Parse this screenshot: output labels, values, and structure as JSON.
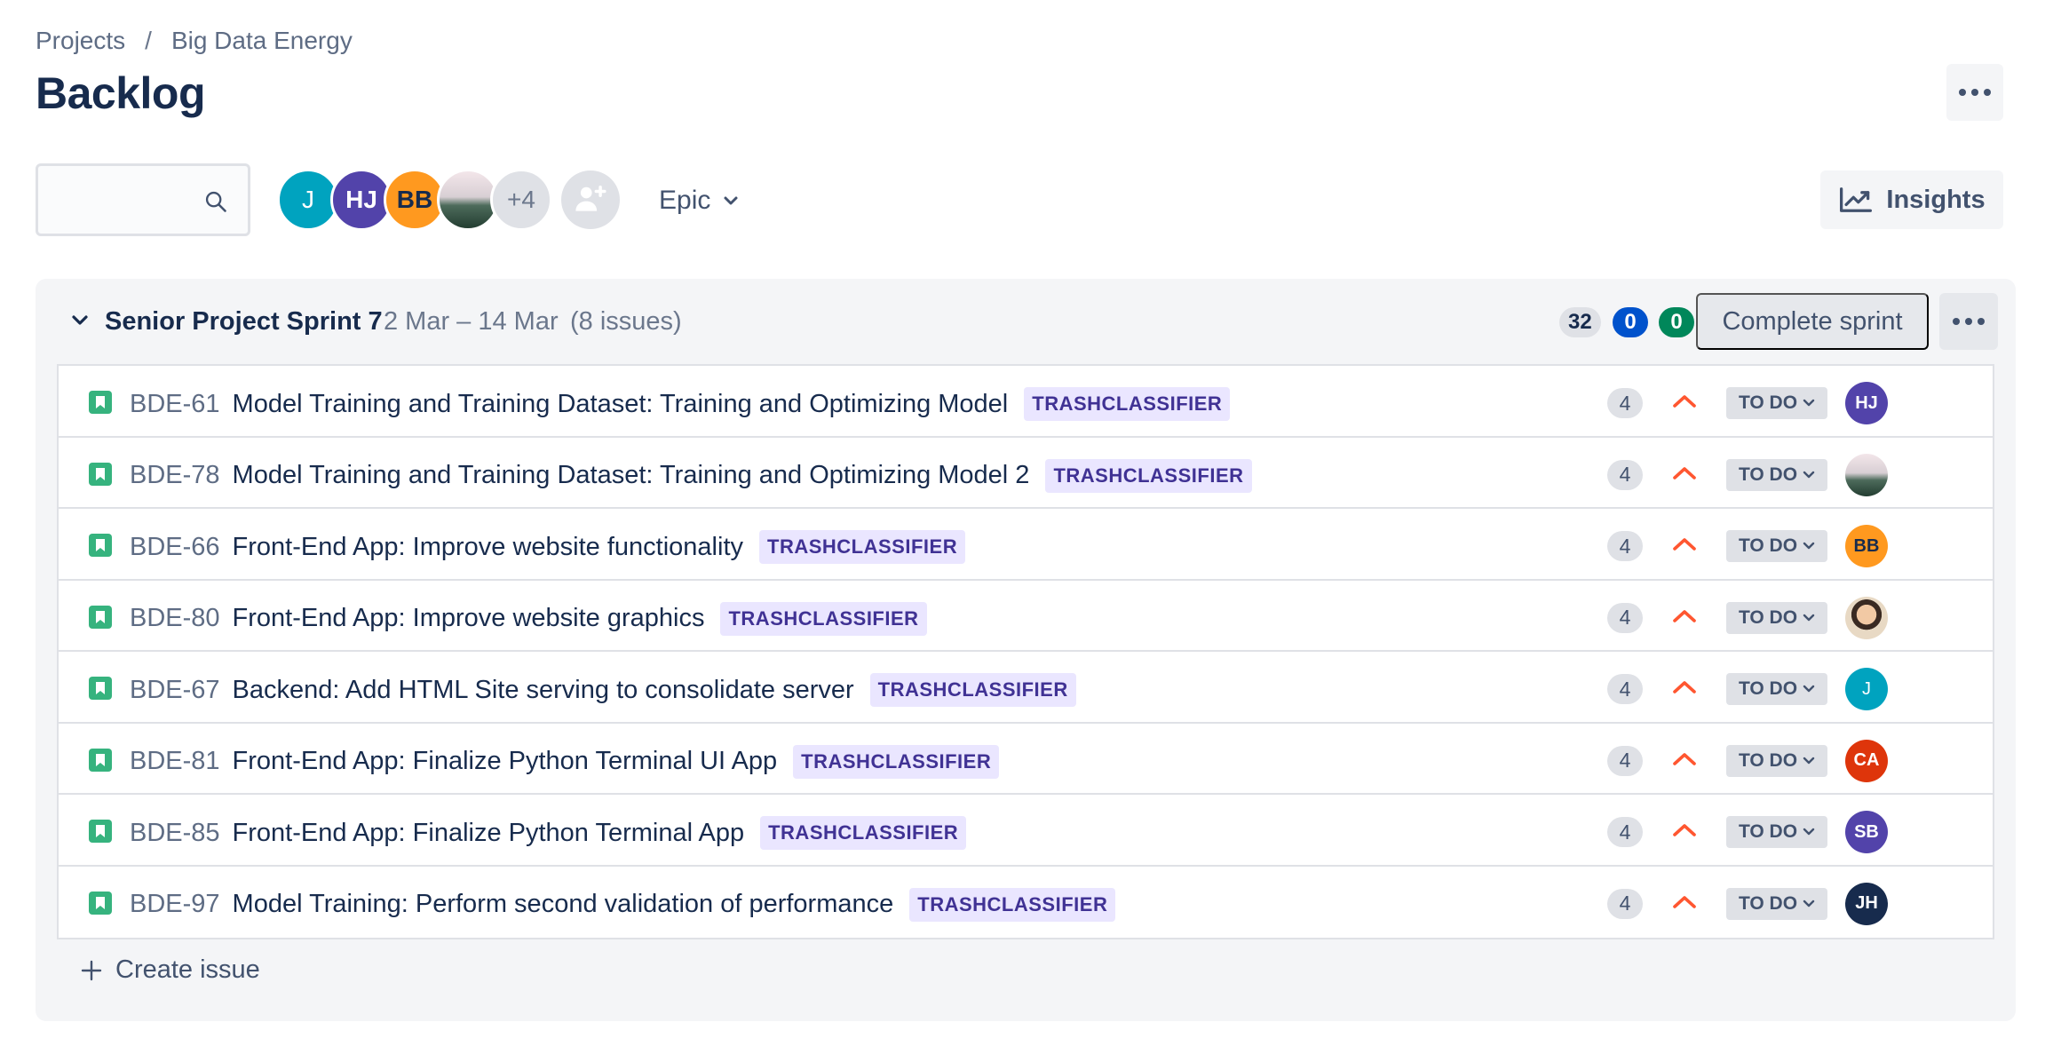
{
  "breadcrumb": {
    "projects": "Projects",
    "separator": "/",
    "project": "Big Data Energy"
  },
  "page": {
    "title": "Backlog"
  },
  "search": {
    "placeholder": "",
    "value": ""
  },
  "team_avatars": [
    {
      "initials": "J",
      "color": "#00a3bf"
    },
    {
      "initials": "HJ",
      "color": "#5243aa"
    },
    {
      "initials": "BB",
      "color": "#ff991f"
    },
    {
      "initials": "",
      "color": "photo"
    },
    {
      "initials": "+4",
      "color": "#dfe1e6"
    }
  ],
  "filters": {
    "epic_label": "Epic"
  },
  "toolbar": {
    "insights_label": "Insights"
  },
  "sprint": {
    "name": "Senior Project Sprint 7",
    "dates": "2 Mar – 14 Mar",
    "issue_count": "(8 issues)",
    "counts": {
      "todo": "32",
      "in_progress": "0",
      "done": "0"
    },
    "complete_label": "Complete sprint",
    "create_issue_label": "Create issue"
  },
  "issues": [
    {
      "key": "BDE-61",
      "summary": "Model Training and Training Dataset: Training and Optimizing Model",
      "epic": "TRASHCLASSIFIER",
      "points": "4",
      "status": "TO DO",
      "assignee": "HJ",
      "assignee_color": "#5243aa"
    },
    {
      "key": "BDE-78",
      "summary": "Model Training and Training Dataset: Training and Optimizing Model 2",
      "epic": "TRASHCLASSIFIER",
      "points": "4",
      "status": "TO DO",
      "assignee": "",
      "assignee_color": "photo-forest"
    },
    {
      "key": "BDE-66",
      "summary": "Front-End App: Improve website functionality",
      "epic": "TRASHCLASSIFIER",
      "points": "4",
      "status": "TO DO",
      "assignee": "BB",
      "assignee_color": "#ff991f"
    },
    {
      "key": "BDE-80",
      "summary": "Front-End App: Improve website graphics",
      "epic": "TRASHCLASSIFIER",
      "points": "4",
      "status": "TO DO",
      "assignee": "",
      "assignee_color": "photo-person"
    },
    {
      "key": "BDE-67",
      "summary": "Backend: Add HTML Site serving to consolidate server",
      "epic": "TRASHCLASSIFIER",
      "points": "4",
      "status": "TO DO",
      "assignee": "J",
      "assignee_color": "#00a3bf"
    },
    {
      "key": "BDE-81",
      "summary": "Front-End App: Finalize Python Terminal UI App",
      "epic": "TRASHCLASSIFIER",
      "points": "4",
      "status": "TO DO",
      "assignee": "CA",
      "assignee_color": "#de350b"
    },
    {
      "key": "BDE-85",
      "summary": "Front-End App: Finalize Python Terminal App",
      "epic": "TRASHCLASSIFIER",
      "points": "4",
      "status": "TO DO",
      "assignee": "SB",
      "assignee_color": "#5243aa"
    },
    {
      "key": "BDE-97",
      "summary": "Model Training: Perform second validation of performance",
      "epic": "TRASHCLASSIFIER",
      "points": "4",
      "status": "TO DO",
      "assignee": "JH",
      "assignee_color": "#172b4d"
    }
  ],
  "colors": {
    "priority_high": "#ff5630",
    "story": "#36b37e",
    "epic_bg": "#eae6ff",
    "epic_text": "#403294",
    "count_todo": "#dfe1e6",
    "count_progress": "#0052cc",
    "count_done": "#00875a"
  }
}
